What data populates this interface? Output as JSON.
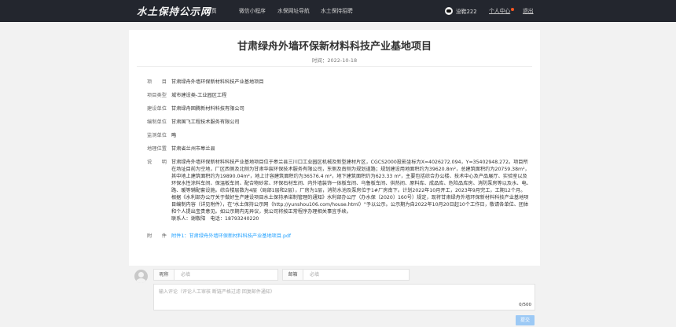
{
  "nav": {
    "logo": "水土保持公示网",
    "menu": [
      "首页",
      "微信小程序",
      "水保网址导航",
      "水土保持招聘"
    ],
    "username": "没鞋222",
    "personal_center": "个人中心",
    "logout": "退出",
    "notify_color": "#ff5722"
  },
  "article": {
    "title": "甘肃绿舟外墙环保新材料科技产业基地项目",
    "time_label": "时间：",
    "time": "2022-10-18",
    "fields": [
      {
        "label": "项目",
        "value": "甘肃绿舟外墙环保新材料科技产业基地项目"
      },
      {
        "label": "项目类型",
        "value": "城市建设类-工业园区工程"
      },
      {
        "label": "建设单位",
        "value": "甘肃绿舟固腾新材料科技有限公司"
      },
      {
        "label": "编制单位",
        "value": "甘肃国飞工程技术服务有限公司"
      },
      {
        "label": "监测单位",
        "value": "略"
      },
      {
        "label": "地理位置",
        "value": "甘肃省兰州市皋兰县"
      }
    ],
    "desc_label": "说明",
    "desc_1": "甘肃绿舟外墙环保新材料科技产业基地项目位于皋兰县三川口工业园区机械及新型建材片区，CGCS2000投影坐标为X=4026272.094，Y=35402948.272。项目所在场址目前为空地，厂区西侧及北侧为甘肃华宸环保技术服务有限公司，东侧及南侧为规划道路；规划建设用地面积约为39620.8m²，总建筑面积约为20759.38m²，其中地上建筑面积约为19890.04m²，地上计容建筑面积约为36576.4 m²，地下建筑面积约为623.33 m²，主要包括综合办公楼、技术中心及产品展厅、实验室以及环保水性涂料车间、保温板车间、配合物砂浆、环保石材车间、内外墙装饰一体板车间、乌鲁板车间、供热间、原料库、成品库、危险品库房、消防泵房等以及水、电、路、暖等辅配套设施。综合楼层数为4层（局部1层和2层），厂房为1层，消防水池及泵房位于1#厂房南下。计划2022年10月开工，2023年9月完工，工期12个月。",
    "desc_2": "根据《水利部办公厅关于做好生产建设项目水土保持承诺制管理的通知》水利部办公厅（办水保〔2020〕160号）规定，现将甘肃绿舟外墙环保新材料科技产业基地项目编制内容（详见附件），在\"水土保持公示网（http://yunshou106.com/house.html）\"予以公示。公示期为自2022年10月20日起10个工作日，敬请各单位、团体和个人提出宝贵意见。如公示期内无异议，我公司将按正常程序办理相关事宜手续。",
    "contact": "联系人：谢敬阳　电话：18793240220",
    "attach_label": "附件",
    "attachment": "附件1：甘肃绿舟外墙环保新材料科技产业基地项目.pdf"
  },
  "comment": {
    "nickname_label": "昵称",
    "nickname_placeholder": "必填",
    "email_label": "邮箱",
    "email_placeholder": "必填",
    "textarea_placeholder": "输入评论（评论人工审核 断链严格过滤 回复邮件通知）",
    "counter": "0/500",
    "submit": "提交"
  }
}
